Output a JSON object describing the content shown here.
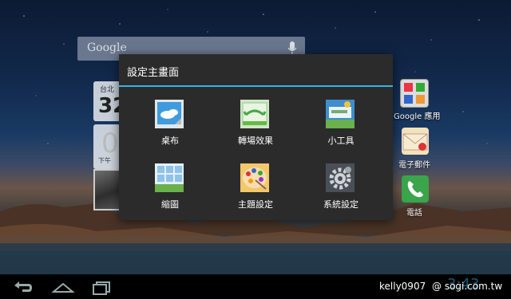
{
  "search": {
    "logo": "Google"
  },
  "widgets": {
    "weather_city": "台北",
    "weather_temp": "32",
    "clock_digit": "0",
    "clock_ampm": "下午"
  },
  "right_icons": [
    {
      "label": "Google 應用",
      "icon": "google-apps-folder-icon"
    },
    {
      "label": "電子郵件",
      "icon": "email-icon"
    },
    {
      "label": "電話",
      "icon": "phone-icon"
    }
  ],
  "dialog": {
    "title": "設定主畫面",
    "options": [
      {
        "label": "桌布",
        "icon": "wallpaper-icon"
      },
      {
        "label": "轉場效果",
        "icon": "transition-effect-icon"
      },
      {
        "label": "小工具",
        "icon": "widget-icon"
      },
      {
        "label": "縮圖",
        "icon": "thumbnail-icon"
      },
      {
        "label": "主題設定",
        "icon": "theme-palette-icon"
      },
      {
        "label": "系統設定",
        "icon": "system-settings-gear-icon"
      }
    ]
  },
  "navbar": {
    "clock": "3:43",
    "watermark_user": "kelly0907",
    "watermark_site": "@ sogi.com.tw"
  },
  "colors": {
    "accent": "#33b5e5",
    "dialog_bg": "#2b2b2b"
  }
}
